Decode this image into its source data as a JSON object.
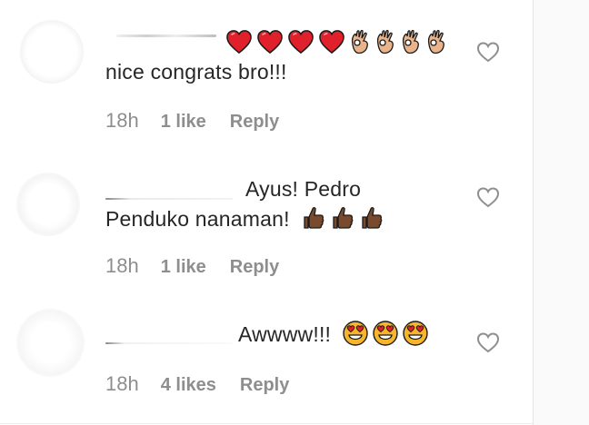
{
  "comments": [
    {
      "text_line1": "",
      "text_line2": "nice congrats bro!!!",
      "emojis": [
        "red-heart",
        "red-heart",
        "red-heart",
        "red-heart",
        "ok-hand",
        "ok-hand",
        "ok-hand",
        "ok-hand"
      ],
      "time": "18h",
      "likes": "1 like",
      "reply_label": "Reply"
    },
    {
      "text_line1": "Ayus! Pedro",
      "text_line2": "Penduko nanaman!",
      "emojis": [
        "thumbs-up",
        "thumbs-up",
        "thumbs-up"
      ],
      "time": "18h",
      "likes": "1 like",
      "reply_label": "Reply"
    },
    {
      "text_line1": "Awwww!!!",
      "text_line2": "",
      "emojis": [
        "heart-eyes-face",
        "heart-eyes-face",
        "heart-eyes-face"
      ],
      "time": "18h",
      "likes": "4 likes",
      "reply_label": "Reply"
    }
  ],
  "colors": {
    "text": "#262626",
    "meta": "#8e8e8e",
    "heart_red": "#e0202a",
    "skin_light": "#e9b48c",
    "skin_dark": "#7a4a2c",
    "face_yellow": "#f7b52b",
    "heart_outline": "#8e8e8e"
  }
}
